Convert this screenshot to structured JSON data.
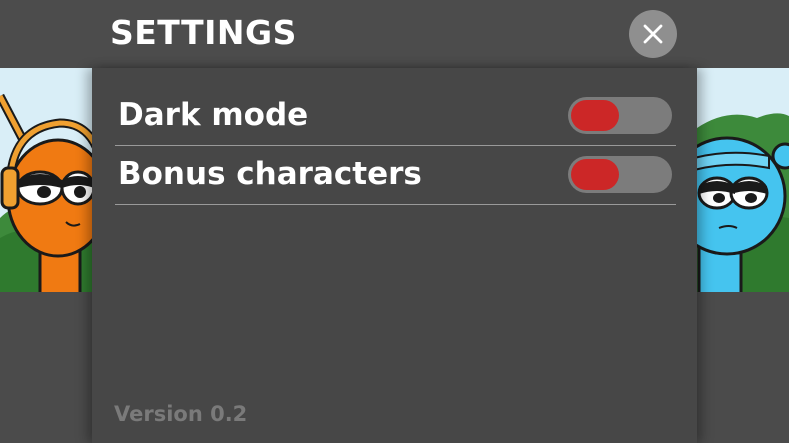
{
  "header": {
    "title": "SETTINGS"
  },
  "settings": [
    {
      "label": "Dark mode",
      "enabled": false
    },
    {
      "label": "Bonus characters",
      "enabled": false
    }
  ],
  "footer": {
    "version": "Version 0.2"
  },
  "colors": {
    "background": "#4b4b4b",
    "panel": "#474747",
    "toggle_track": "#7c7c7c",
    "toggle_knob": "#cc2727",
    "close_button": "#8f8f8f",
    "text": "#ffffff",
    "muted_text": "#7a7a7a"
  },
  "icons": {
    "close": "close-icon",
    "left_character": "orange-character-with-headphones",
    "right_character": "blue-character-with-headband"
  }
}
